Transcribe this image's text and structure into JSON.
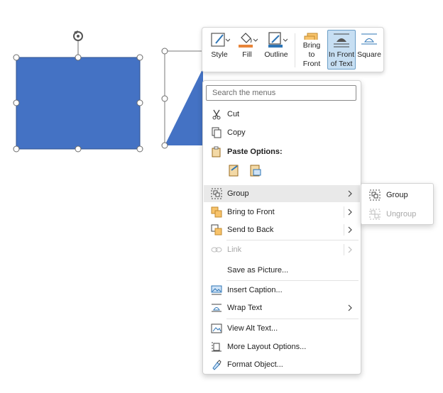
{
  "colors": {
    "shape_fill": "#4472c4",
    "selection_active": "#c7dff3",
    "accent_orange": "#e8853a",
    "accent_blue": "#2e75b6"
  },
  "toolbar": {
    "style_label": "Style",
    "fill_label": "Fill",
    "outline_label": "Outline",
    "bring_to_front_label": "Bring to\nFront",
    "in_front_of_text_label": "In Front\nof Text",
    "square_label": "Square"
  },
  "menu": {
    "search_placeholder": "Search the menus",
    "cut": "Cut",
    "copy": "Copy",
    "paste_options": "Paste Options:",
    "group": "Group",
    "bring_to_front": "Bring to Front",
    "send_to_back": "Send to Back",
    "link": "Link",
    "save_as_picture": "Save as Picture...",
    "insert_caption": "Insert Caption...",
    "wrap_text": "Wrap Text",
    "view_alt_text": "View Alt Text...",
    "more_layout_options": "More Layout Options...",
    "format_object": "Format Object..."
  },
  "submenu": {
    "group": "Group",
    "ungroup": "Ungroup"
  }
}
